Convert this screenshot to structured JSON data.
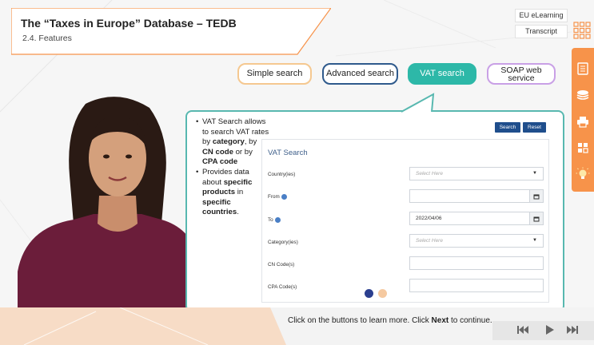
{
  "course": {
    "title": "The “Taxes in Europe” Database – TEDB",
    "subtitle": "2.4. Features"
  },
  "top_buttons": {
    "eu_elearning": "EU eLearning",
    "transcript": "Transcript"
  },
  "side_toolbar": {
    "icons": [
      "document-icon",
      "layers-icon",
      "print-icon",
      "grid-apps-icon",
      "lightbulb-icon"
    ]
  },
  "tabs": [
    {
      "label": "Simple search",
      "color": "#f5c890",
      "active": false
    },
    {
      "label": "Advanced search",
      "color": "#2f5a8c",
      "active": false
    },
    {
      "label": "VAT search",
      "color": "#2db8a8",
      "active": true
    },
    {
      "label_line1": "SOAP web",
      "label_line2": "service",
      "color": "#c9a0e6",
      "active": false
    }
  ],
  "content": {
    "bullet1": {
      "t1": "VAT Search allows to search VAT rates by ",
      "b1": "category",
      "t2": ", by ",
      "b2": "CN code",
      "t3": " or by ",
      "b3": "CPA code"
    },
    "bullet2": {
      "t1": "Provides data about ",
      "b1": "specific products",
      "t2": " in ",
      "b2": "specific countries",
      "t3": "."
    }
  },
  "vat_form": {
    "title": "VAT Search",
    "search_button": "Search",
    "reset_button": "Reset",
    "fields": {
      "country_label": "Country(ies)",
      "country_placeholder": "Select Here",
      "from_label": "From",
      "from_value": "",
      "to_label": "To",
      "to_value": "2022/04/06",
      "category_label": "Category(ies)",
      "category_placeholder": "Select Here",
      "cn_label": "CN Code(s)",
      "cn_value": "",
      "cpa_label": "CPA Code(s)",
      "cpa_value": ""
    }
  },
  "pagination": {
    "current": 1,
    "total": 2,
    "active_color": "#2b3f8f",
    "inactive_color": "#f5c9a0"
  },
  "footer": {
    "instruction_pre": "Click on the buttons to learn more. Click ",
    "instruction_bold": "Next",
    "instruction_post": " to continue."
  },
  "colors": {
    "accent_orange": "#f7934a",
    "panel_border": "#58b8b0",
    "form_button": "#1f4e8c"
  }
}
